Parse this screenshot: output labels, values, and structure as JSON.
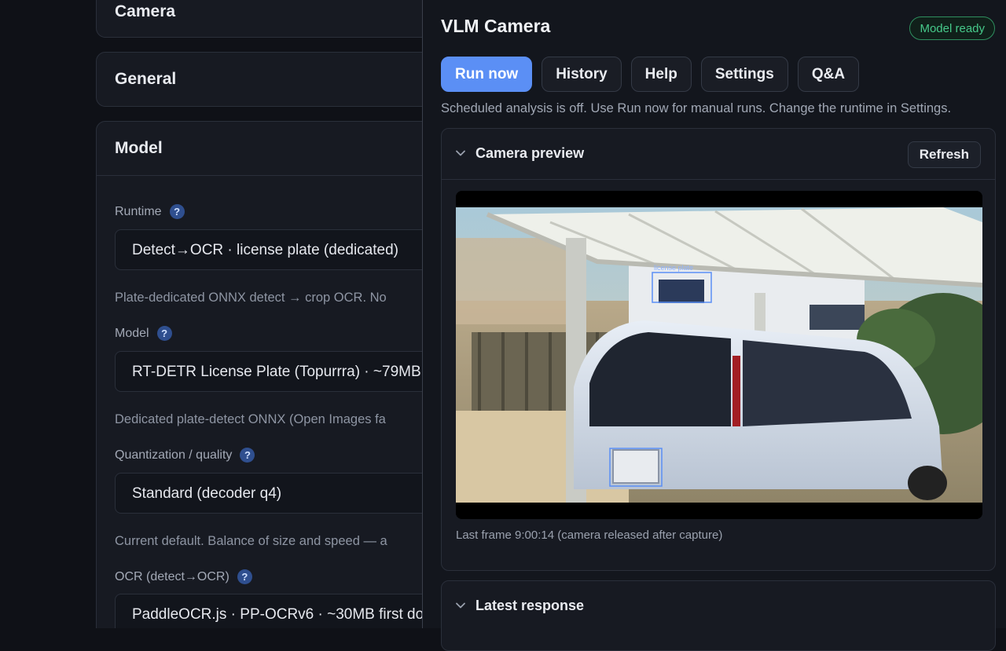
{
  "settings": {
    "camera_title": "Camera",
    "general_title": "General",
    "model_title": "Model",
    "runtime": {
      "label": "Runtime",
      "value": "Detect→OCR · license plate (dedicated)",
      "hint": "Plate-dedicated ONNX detect → crop OCR. No"
    },
    "model": {
      "label": "Model",
      "value": "RT-DETR License Plate (Topurrra) · ~79MB",
      "hint": "Dedicated plate-detect ONNX (Open Images fa"
    },
    "quantization": {
      "label": "Quantization / quality",
      "value": "Standard (decoder q4)",
      "hint": "Current default. Balance of size and speed — a"
    },
    "ocr": {
      "label": "OCR (detect→OCR)",
      "value": "PaddleOCR.js · PP-OCRv6 · ~30MB first do"
    },
    "help_glyph": "?"
  },
  "panel": {
    "title": "VLM Camera",
    "status_badge": "Model ready",
    "tabs": {
      "run_now": "Run now",
      "history": "History",
      "help": "Help",
      "settings": "Settings",
      "qa": "Q&A"
    },
    "notice": "Scheduled analysis is off. Use Run now for manual runs. Change the runtime in Settings.",
    "preview": {
      "title": "Camera preview",
      "refresh": "Refresh",
      "caption": "Last frame 9:00:14 (camera released after capture)",
      "overlay_label": "license plate"
    },
    "latest_response": {
      "title": "Latest response"
    }
  },
  "colors": {
    "accent": "#5b8ff5",
    "ready": "#46c98a",
    "background": "#0f1117"
  }
}
